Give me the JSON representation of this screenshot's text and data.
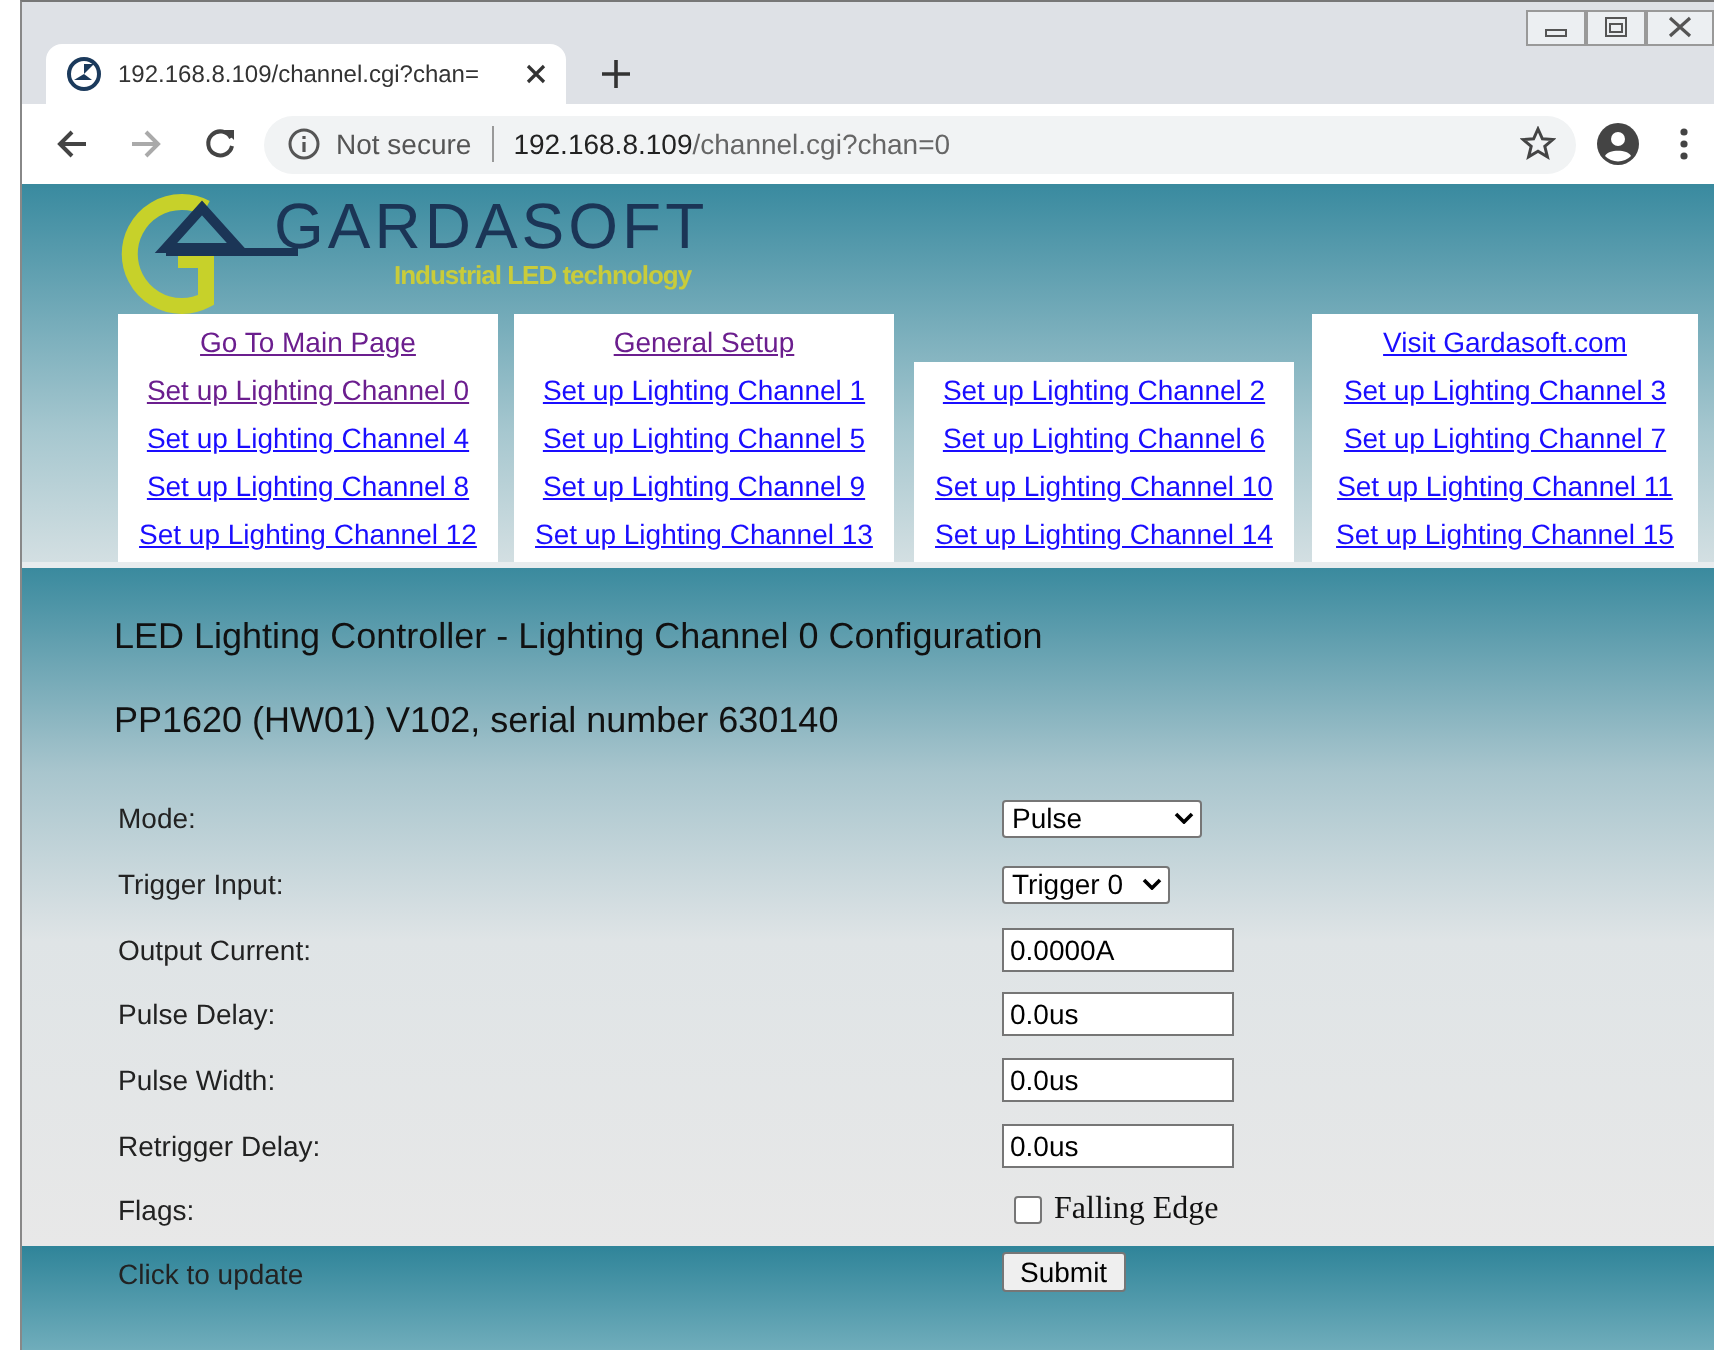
{
  "browser": {
    "tab_title": "192.168.8.109/channel.cgi?chan=",
    "security": "Not secure",
    "url_host": "192.168.8.109",
    "url_path": "/channel.cgi?chan=0"
  },
  "logo": {
    "name": "GARDASOFT",
    "tagline": "Industrial LED technology"
  },
  "nav_columns": [
    {
      "links": [
        {
          "label": "Go To Main Page",
          "visited": true
        },
        {
          "label": "Set up Lighting Channel 0",
          "visited": true
        },
        {
          "label": "Set up Lighting Channel 4",
          "visited": false
        },
        {
          "label": "Set up Lighting Channel 8",
          "visited": false
        },
        {
          "label": "Set up Lighting Channel 12",
          "visited": false
        }
      ]
    },
    {
      "links": [
        {
          "label": "General Setup",
          "visited": true
        },
        {
          "label": "Set up Lighting Channel 1",
          "visited": false
        },
        {
          "label": "Set up Lighting Channel 5",
          "visited": false
        },
        {
          "label": "Set up Lighting Channel 9",
          "visited": false
        },
        {
          "label": "Set up Lighting Channel 13",
          "visited": false
        }
      ]
    },
    {
      "links": [
        {
          "label": "Set up Lighting Channel 2",
          "visited": false
        },
        {
          "label": "Set up Lighting Channel 6",
          "visited": false
        },
        {
          "label": "Set up Lighting Channel 10",
          "visited": false
        },
        {
          "label": "Set up Lighting Channel 14",
          "visited": false
        }
      ]
    },
    {
      "links": [
        {
          "label": "Visit Gardasoft.com",
          "visited": false
        },
        {
          "label": "Set up Lighting Channel 3",
          "visited": false
        },
        {
          "label": "Set up Lighting Channel 7",
          "visited": false
        },
        {
          "label": "Set up Lighting Channel 11",
          "visited": false
        },
        {
          "label": "Set up Lighting Channel 15",
          "visited": false
        }
      ]
    }
  ],
  "heading": "LED Lighting Controller - Lighting Channel 0 Configuration",
  "device": "PP1620 (HW01) V102, serial number 630140",
  "form_rows": [
    {
      "kind": "select",
      "label": "Mode:",
      "value": "Pulse"
    },
    {
      "kind": "select",
      "label": "Trigger Input:",
      "value": "Trigger 0"
    },
    {
      "kind": "input",
      "label": "Output Current:",
      "value": "0.0000A"
    },
    {
      "kind": "input",
      "label": "Pulse Delay:",
      "value": "0.0us"
    },
    {
      "kind": "input",
      "label": "Pulse Width:",
      "value": "0.0us"
    },
    {
      "kind": "input",
      "label": "Retrigger Delay:",
      "value": "0.0us"
    },
    {
      "kind": "checkbox",
      "label": "Flags:",
      "option": "Falling Edge",
      "checked": false
    }
  ],
  "submit_row": {
    "label": "Click to update",
    "button": "Submit"
  }
}
